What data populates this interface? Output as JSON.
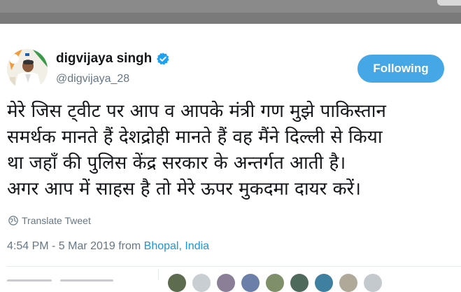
{
  "tweet": {
    "author_name": "digvijaya singh",
    "handle": "@digvijaya_28",
    "follow_label": "Following",
    "text_lines": [
      "मेरे जिस ट्वीट पर आप व आपके मंत्री गण मुझे पाकिस्तान",
      "समर्थक मानते हैं देशद्रोही मानते हैं वह मैंने दिल्ली से किया",
      "था जहॉं की पुलिस केंद्र सरकार के अन्तर्गत आती है।",
      "अगर आप में साहस है तो मेरे ऊपर मुकदमा दायर करें।"
    ],
    "translate_label": "Translate Tweet",
    "timestamp": "4:54 PM - 5 Mar 2019 from",
    "location": "Bhopal, India"
  },
  "colors": {
    "accent": "#45a7e6",
    "link": "#1b95e0",
    "verified": "#1da1f2",
    "secondary_text": "#657786"
  },
  "icons": {
    "verified": "verified-badge-icon",
    "translate": "globe-icon"
  }
}
